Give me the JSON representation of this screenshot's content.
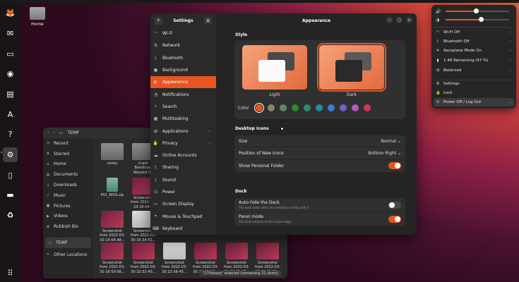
{
  "desktop": {
    "home_label": "Home"
  },
  "dock": {
    "items": [
      {
        "name": "firefox-icon",
        "glyph": "🦊"
      },
      {
        "name": "thunderbird-icon",
        "glyph": "✉"
      },
      {
        "name": "files-icon",
        "glyph": "▭"
      },
      {
        "name": "rhythmbox-icon",
        "glyph": "◉"
      },
      {
        "name": "libreoffice-writer-icon",
        "glyph": "▤"
      },
      {
        "name": "app-center-icon",
        "glyph": "A"
      },
      {
        "name": "help-icon",
        "glyph": "?"
      },
      {
        "name": "settings-icon",
        "glyph": "⚙"
      },
      {
        "name": "usb-drive-icon",
        "glyph": "▯"
      },
      {
        "name": "disk-icon",
        "glyph": "▬"
      },
      {
        "name": "trash-icon",
        "glyph": "♻"
      }
    ],
    "show_apps_glyph": "⠿"
  },
  "files": {
    "path": "TEMP",
    "sidebar": [
      {
        "label": "Recent",
        "icon": "◷"
      },
      {
        "label": "Starred",
        "icon": "★"
      },
      {
        "label": "Home",
        "icon": "⌂"
      },
      {
        "label": "Documents",
        "icon": "▤"
      },
      {
        "label": "Downloads",
        "icon": "↓"
      },
      {
        "label": "Music",
        "icon": "♪"
      },
      {
        "label": "Pictures",
        "icon": "▣"
      },
      {
        "label": "Videos",
        "icon": "▶"
      },
      {
        "label": "Rubbish Bin",
        "icon": "♻"
      },
      {
        "label": "TEMP",
        "icon": "▭"
      },
      {
        "label": "Other Locations",
        "icon": "+"
      }
    ],
    "items": [
      {
        "label": "conky",
        "kind": "folder"
      },
      {
        "label": "Crash Bandicoot Warped (U)",
        "kind": "folder"
      },
      {
        "label": "PS1_BIOS.zip",
        "kind": "zip"
      },
      {
        "label": "Screenshot from 2022-03-29 16-04-5",
        "kind": "img"
      },
      {
        "label": "Screenshot from 2022-03-30 14-04-48...",
        "kind": "img"
      },
      {
        "label": "Screenshot from 2022-03-30 16-34-51...",
        "kind": "doc"
      },
      {
        "label": "Screenshot from 2022-03-30 16-59-56...",
        "kind": "img"
      },
      {
        "label": "Screenshot from 2022-03-30 22-32-45...",
        "kind": "img"
      },
      {
        "label": "Screenshot from 2022-03-30 22-36-45...",
        "kind": "doc"
      },
      {
        "label": "Screenshot from 2022-03-30 22-38-04...",
        "kind": "img"
      },
      {
        "label": "Screenshot from 2022-03-30 22-39-47...",
        "kind": "img"
      },
      {
        "label": "Screenshot from 2022-03-30 22-40-33...",
        "kind": "img"
      }
    ],
    "status": "\"175dsoop\" selected (containing 21 items)"
  },
  "settings": {
    "sidebar_title": "Settings",
    "title": "Appearance",
    "nav": [
      {
        "label": "Wi-Fi",
        "icon": "◠",
        "chev": ""
      },
      {
        "label": "Network",
        "icon": "⇅",
        "chev": ""
      },
      {
        "label": "Bluetooth",
        "icon": "ᛒ",
        "chev": ""
      },
      {
        "label": "Background",
        "icon": "▣",
        "chev": ""
      },
      {
        "label": "Appearance",
        "icon": "◐",
        "chev": ""
      },
      {
        "label": "Notifications",
        "icon": "◔",
        "chev": ""
      },
      {
        "label": "Search",
        "icon": "⌕",
        "chev": ""
      },
      {
        "label": "Multitasking",
        "icon": "▦",
        "chev": ""
      },
      {
        "label": "Applications",
        "icon": "⊞",
        "chev": "›"
      },
      {
        "label": "Privacy",
        "icon": "✋",
        "chev": "›"
      },
      {
        "label": "Online Accounts",
        "icon": "☁",
        "chev": ""
      },
      {
        "label": "Sharing",
        "icon": "⇪",
        "chev": ""
      },
      {
        "label": "Sound",
        "icon": "♪",
        "chev": ""
      },
      {
        "label": "Power",
        "icon": "⏻",
        "chev": ""
      },
      {
        "label": "Screen Display",
        "icon": "▭",
        "chev": ""
      },
      {
        "label": "Mouse & Touchpad",
        "icon": "⌖",
        "chev": ""
      },
      {
        "label": "Keyboard",
        "icon": "⌨",
        "chev": ""
      }
    ],
    "style_title": "Style",
    "light_label": "Light",
    "dark_label": "Dark",
    "color_label": "Color",
    "colors": [
      "#e95420",
      "#7e8a6c",
      "#5b8a5a",
      "#2b8a2b",
      "#2b8a6e",
      "#2b8aa0",
      "#3a7bd5",
      "#7a5ad0",
      "#b05ac6",
      "#d6335b"
    ],
    "desktop_icons_title": "Desktop Icons",
    "size_label": "Size",
    "size_value": "Normal",
    "position_label": "Position of New Icons",
    "position_value": "Bottom Right",
    "personal_folder_label": "Show Personal Folder",
    "personal_folder_on": true,
    "dock_title": "Dock",
    "autohide_label": "Auto-hide the Dock",
    "autohide_desc": "The dock hides when any windows overlap with it.",
    "autohide_on": false,
    "panel_label": "Panel mode",
    "panel_desc": "The dock extends to the screen edge.",
    "panel_on": true
  },
  "quick_settings": {
    "volume": 0.48,
    "brightness": 0.55,
    "items": [
      {
        "label": "Wi-Fi Off",
        "icon": "◠",
        "chev": "›"
      },
      {
        "label": "Bluetooth Off",
        "icon": "ᛒ",
        "chev": "›"
      },
      {
        "label": "Aeroplane Mode On",
        "icon": "✈",
        "chev": "›"
      },
      {
        "label": "1:48 Remaining (47 %)",
        "icon": "▮",
        "chev": "›"
      },
      {
        "label": "Balanced",
        "icon": "◔",
        "chev": "›"
      }
    ],
    "settings_label": "Settings",
    "lock_label": "Lock",
    "power_label": "Power Off / Log Out"
  }
}
